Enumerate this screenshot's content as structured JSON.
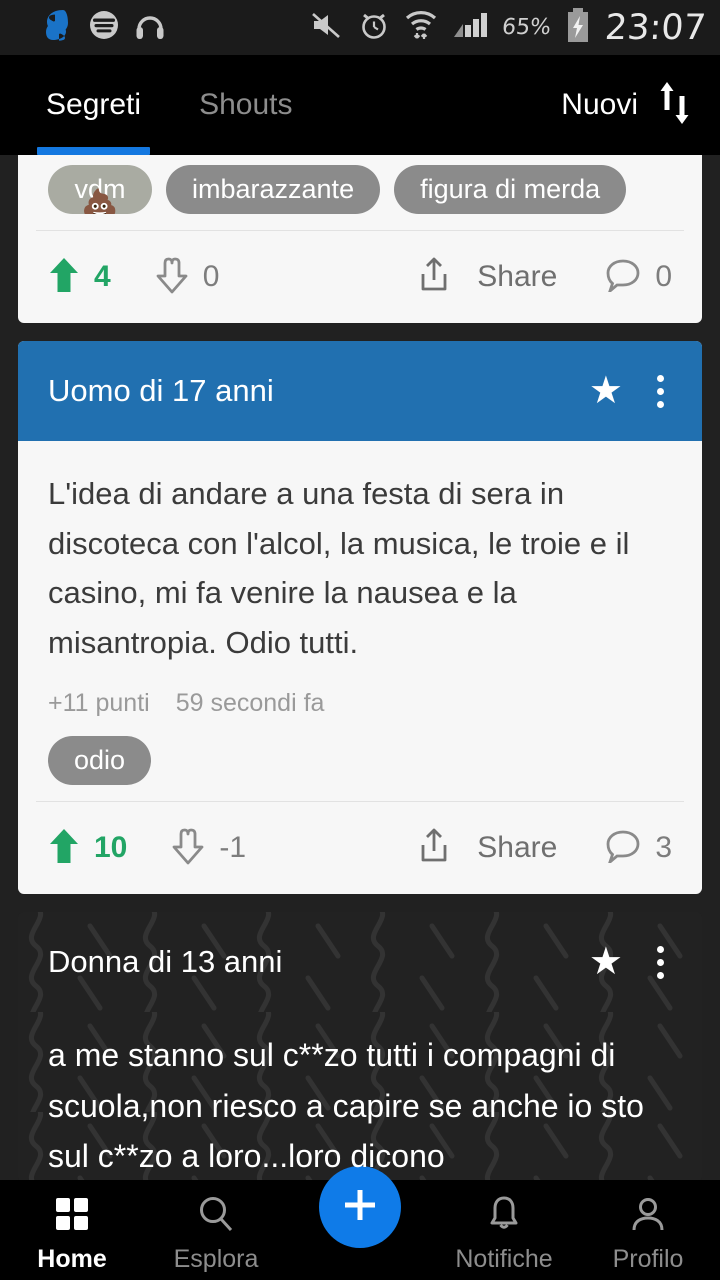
{
  "statusbar": {
    "time": "23:07",
    "battery_text": "65%",
    "left_icons": [
      "secret-app-icon",
      "spotify-icon",
      "headphones-icon"
    ],
    "right_icons": [
      "mute-icon",
      "alarm-icon",
      "wifi-icon",
      "signal-icon",
      "battery-charging-icon"
    ]
  },
  "header": {
    "tabs": [
      {
        "label": "Segreti",
        "active": true
      },
      {
        "label": "Shouts",
        "active": false
      }
    ],
    "sort_label": "Nuovi",
    "sort_icon": "sort-arrows-icon",
    "accent_color": "#1478e0"
  },
  "feed": {
    "cards": [
      {
        "kind": "partial-bottom",
        "tags": [
          "vdm",
          "imbarazzante",
          "figura di merda"
        ],
        "tag_emoji": "poop-emoji",
        "actions": {
          "upvote_count": "4",
          "downvote_count": "0",
          "share_label": "Share",
          "comment_count": "0"
        }
      },
      {
        "kind": "light",
        "author": "Uomo di 17 anni",
        "header_color": "#2170b0",
        "text": "L'idea di andare a una festa di sera in discoteca con l'alcol, la musica, le troie e il casino, mi fa venire la nausea e la misantropia. Odio tutti.",
        "points": "+11 punti",
        "timestamp": "59 secondi fa",
        "tags": [
          "odio"
        ],
        "actions": {
          "upvote_count": "10",
          "downvote_count": "-1",
          "share_label": "Share",
          "comment_count": "3"
        },
        "favorite_icon": "star-icon",
        "menu_icon": "kebab-menu-icon"
      },
      {
        "kind": "dark-pattern",
        "author": "Donna di 13 anni",
        "text": "a me stanno sul c**zo tutti i compagni di scuola,non riesco a capire se anche io sto sul c**zo a loro...loro dicono",
        "favorite_icon": "star-icon",
        "menu_icon": "kebab-menu-icon"
      }
    ],
    "colors": {
      "upvote_green": "#22a565",
      "tag_gray": "#8b8b8b",
      "card_bg": "#f7f7f7",
      "page_bg": "#212121"
    }
  },
  "bottomnav": {
    "items": [
      {
        "label": "Home",
        "icon": "grid-icon",
        "active": true
      },
      {
        "label": "Esplora",
        "icon": "search-icon",
        "active": false
      },
      {
        "label": "Notifiche",
        "icon": "bell-icon",
        "active": false
      },
      {
        "label": "Profilo",
        "icon": "person-icon",
        "active": false
      }
    ],
    "fab": {
      "icon": "plus-icon",
      "color": "#0f7be8"
    }
  }
}
